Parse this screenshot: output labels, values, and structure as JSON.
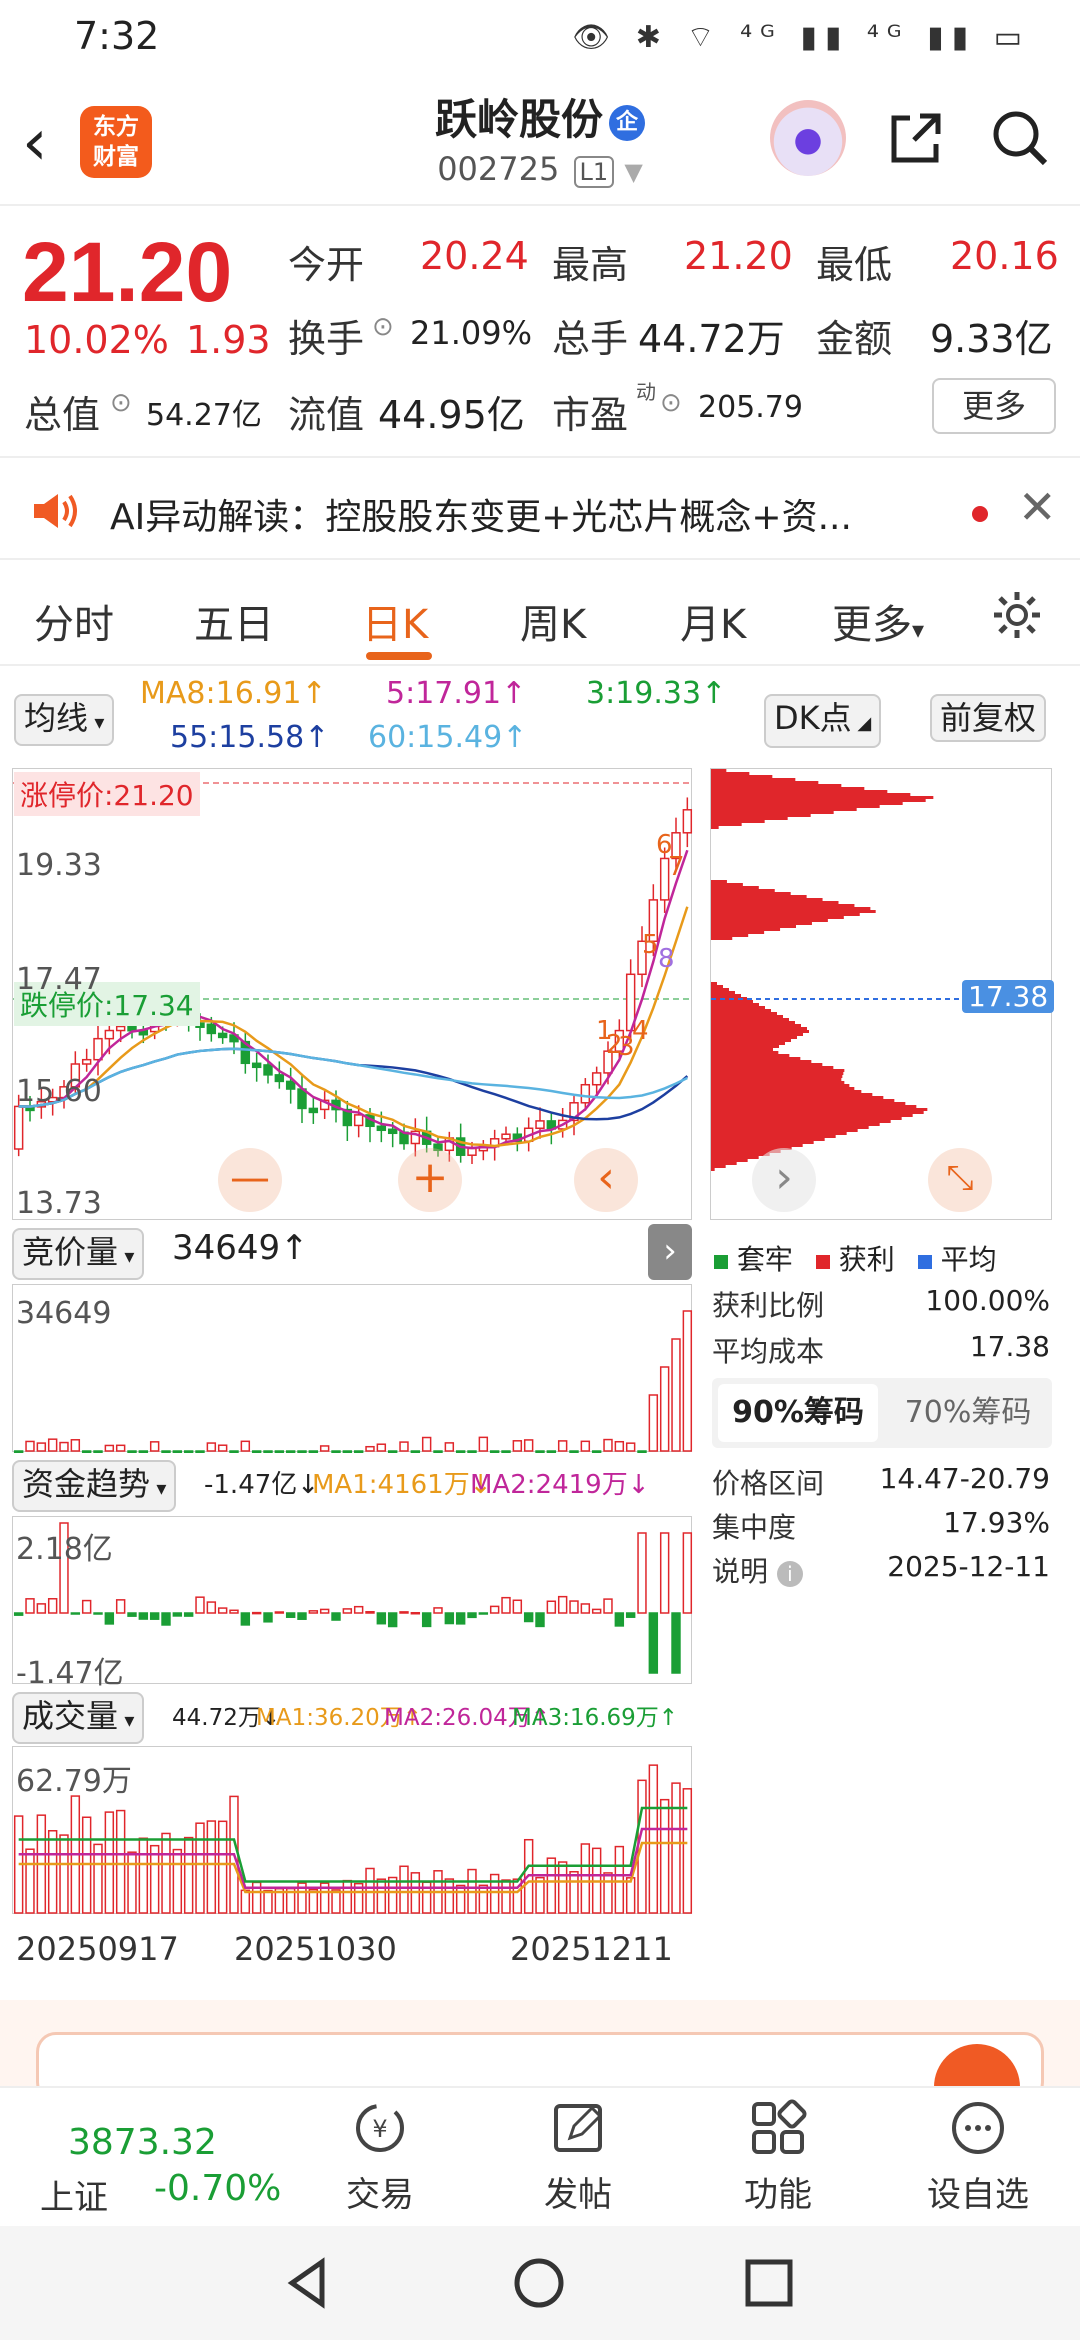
{
  "status": {
    "time": "7:32",
    "icons": "👁 ✱ ⌔ ⁴ᴳ ▮▮ ⁴ᴳ ▮▮ ▭"
  },
  "header": {
    "back": "‹",
    "logo_line1": "东方",
    "logo_line2": "财富",
    "title": "跃岭股份",
    "qi": "企",
    "code": "002725",
    "code_tag": "L1"
  },
  "quote": {
    "price": "21.20",
    "pct": "10.02%",
    "chg": "1.93",
    "open_label": "今开",
    "open": "20.24",
    "high_label": "最高",
    "high": "21.20",
    "low_label": "最低",
    "low": "20.16",
    "turnover_label": "换手",
    "turnover": "21.09%",
    "vol_label": "总手",
    "vol": "44.72万",
    "amount_label": "金额",
    "amount": "9.33亿",
    "mcap_label": "总值",
    "mcap": "54.27亿",
    "float_label": "流值",
    "float": "44.95亿",
    "pe_label": "市盈",
    "pe_sup": "动",
    "pe": "205.79",
    "more": "更多"
  },
  "ai": {
    "text": "AI异动解读：控股股东变更+光芯片概念+资..."
  },
  "tabs": [
    "分时",
    "五日",
    "日K",
    "周K",
    "月K",
    "更多"
  ],
  "ma": {
    "select": "均线",
    "ma8": "MA8:16.91↑",
    "ma5": "5:17.91↑",
    "ma3": "3:19.33↑",
    "ma55": "55:15.58↑",
    "ma60": "60:15.49↑",
    "dk": "DK点",
    "fq": "前复权"
  },
  "kchart": {
    "limit_up": "涨停价:21.20",
    "limit_down": "跌停价:17.34",
    "y1": "19.33",
    "y2": "17.47",
    "y3": "15.60",
    "y4": "13.73",
    "marks": [
      "1",
      "2",
      "3",
      "4",
      "5",
      "6",
      "7",
      "8"
    ],
    "chip_avg": "17.38"
  },
  "auction": {
    "select": "竞价量",
    "value": "34649↑",
    "ymax": "34649"
  },
  "fund": {
    "select": "资金趋势",
    "v": "-1.47亿↓",
    "ma1": "MA1:4161万↓",
    "ma2": "MA2:2419万↓",
    "ymax": "2.18亿",
    "ymin": "-1.47亿"
  },
  "volume": {
    "select": "成交量",
    "v": "44.72万↓",
    "ma1": "MA1:36.20万↑",
    "ma2": "MA2:26.04万↑",
    "ma3": "MA3:16.69万↑",
    "ymax": "62.79万"
  },
  "dates": [
    "20250917",
    "20251030",
    "20251211"
  ],
  "chip": {
    "legend": [
      "套牢",
      "获利",
      "平均"
    ],
    "profit_label": "获利比例",
    "profit": "100.00%",
    "cost_label": "平均成本",
    "cost": "17.38",
    "tab1": "90%筹码",
    "tab2": "70%筹码",
    "range_label": "价格区间",
    "range": "14.47-20.79",
    "conc_label": "集中度",
    "conc": "17.93%",
    "note_label": "说明",
    "note": "2025-12-11"
  },
  "bottom": {
    "index_value": "3873.32",
    "index_name": "上证",
    "index_pct": "-0.70%",
    "items": [
      "交易",
      "发帖",
      "功能",
      "设自选"
    ]
  },
  "colors": {
    "up": "#e0262b",
    "down": "#1a9e35",
    "accent": "#e8641b"
  }
}
